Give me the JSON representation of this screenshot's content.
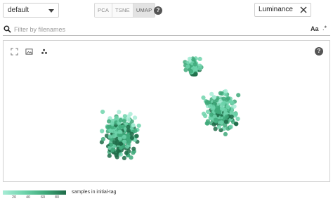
{
  "toolbar": {
    "preset_value": "default",
    "projections": [
      {
        "label": "PCA",
        "active": false
      },
      {
        "label": "TSNE",
        "active": false
      },
      {
        "label": "UMAP",
        "active": true
      }
    ],
    "help_icon": "question-circle-icon",
    "color_field_value": "Luminance",
    "clear_icon": "close-icon"
  },
  "filter": {
    "placeholder": "Filter by filenames",
    "value": "",
    "search_icon": "search-icon",
    "case_toggle_label": "Aa",
    "regex_toggle_label": ".*"
  },
  "panel": {
    "tools": [
      "fit-view-icon",
      "image-mode-icon",
      "point-mode-icon"
    ],
    "help_icon": "question-circle-icon"
  },
  "legend": {
    "ticks": [
      "20",
      "40",
      "60",
      "80"
    ],
    "label": "samples in initial-tag",
    "colors": [
      "#a8ecd6",
      "#6fd4ac",
      "#3fa97a",
      "#1f6b48"
    ]
  }
}
